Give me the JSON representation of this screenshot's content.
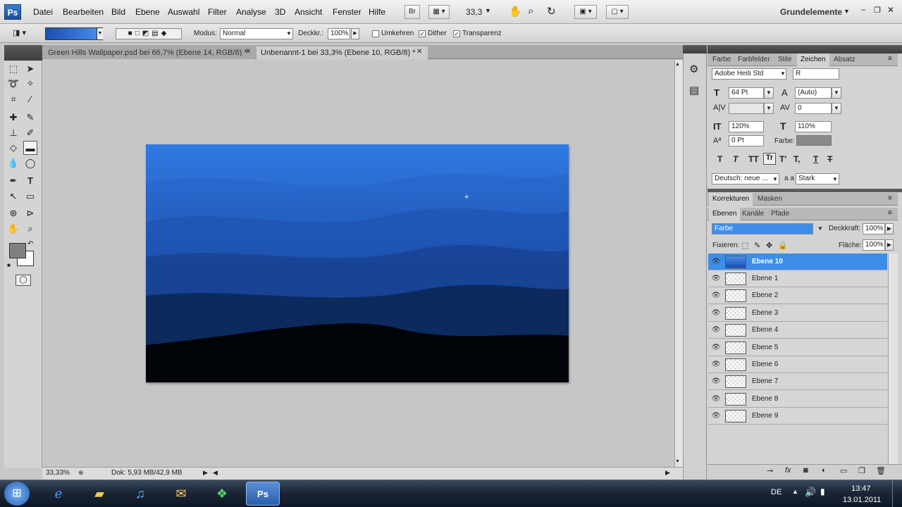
{
  "app": {
    "logo": "Ps"
  },
  "menu": [
    "Datei",
    "Bearbeiten",
    "Bild",
    "Ebene",
    "Auswahl",
    "Filter",
    "Analyse",
    "3D",
    "Ansicht",
    "Fenster",
    "Hilfe"
  ],
  "menubar_extra": {
    "bridge": "Br",
    "zoom": "33,3",
    "workspace": "Grundelemente"
  },
  "options": {
    "modus_label": "Modus:",
    "modus_value": "Normal",
    "deckkr_label": "Deckkr.:",
    "deckkr_value": "100%",
    "umkehren": "Umkehren",
    "dither": "Dither",
    "transparenz": "Transparenz"
  },
  "tabs": [
    {
      "label": "Green Hills Wallpaper.psd bei 66,7% (Ebene 14, RGB/8) *"
    },
    {
      "label": "Unbenannt-1 bei 33,3% (Ebene 10, RGB/8) *"
    }
  ],
  "status": {
    "zoom": "33,33%",
    "doc": "Dok: 5,93 MB/42,9 MB"
  },
  "char_tabs": [
    "Farbe",
    "Farbfelder",
    "Stile",
    "Zeichen",
    "Absatz"
  ],
  "char": {
    "font": "Adobe Heiti Std",
    "style": "R",
    "size": "64 Pt",
    "leading": "(Auto)",
    "tracking": "0",
    "vscale": "120%",
    "hscale": "110%",
    "baseline": "0 Pt",
    "color_label": "Farbe:",
    "language": "Deutsch: neue ...",
    "aa_label": "a a",
    "aa": "Stark"
  },
  "type_buttons": [
    "T",
    "T",
    "TT",
    "Tr",
    "T'",
    "T,",
    "T",
    "T"
  ],
  "adj_tabs": [
    "Korrekturen",
    "Masken"
  ],
  "layer_tabs": [
    "Ebenen",
    "Kanäle",
    "Pfade"
  ],
  "layers_panel": {
    "blend": "Farbe",
    "opacity_label": "Deckkraft:",
    "opacity": "100%",
    "lock_label": "Fixieren:",
    "fill_label": "Fläche:",
    "fill": "100%"
  },
  "layers": [
    "Ebene 10",
    "Ebene 1",
    "Ebene 2",
    "Ebene 3",
    "Ebene 4",
    "Ebene 5",
    "Ebene 6",
    "Ebene 7",
    "Ebene 8",
    "Ebene 9"
  ],
  "taskbar": {
    "lang": "DE",
    "time": "13:47",
    "date": "13.01.2011"
  },
  "colors": {
    "accent": "#3d8ee8",
    "canvas_top": "#2f7ae2",
    "canvas_bottom": "#000000"
  }
}
